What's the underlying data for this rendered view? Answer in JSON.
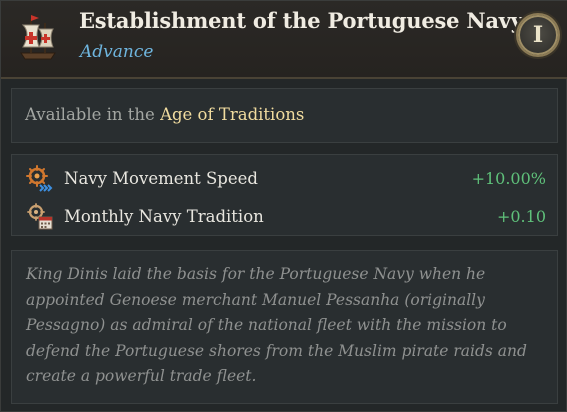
{
  "header": {
    "icon": "caravel-ship-icon",
    "title": "Establishment of the Portuguese Navy",
    "subtitle": "Advance",
    "badge": "I"
  },
  "availability": {
    "prefix": "Available in the ",
    "age": "Age of Traditions"
  },
  "modifiers": [
    {
      "icon": "ship-wheel-speed-icon",
      "label": "Navy Movement Speed",
      "value": "+10.00%"
    },
    {
      "icon": "ship-wheel-calendar-icon",
      "label": "Monthly Navy Tradition",
      "value": "+0.10"
    }
  ],
  "description": "King Dinis laid the basis for the Portuguese Navy when he appointed Genoese merchant Manuel Pessanha (originally Pessagno) as admiral of the national fleet with the mission to defend the Portuguese shores from the Muslim pirate raids and create a powerful trade fleet.",
  "colors": {
    "title": "#f0ece2",
    "subtitle": "#6fb5de",
    "age_highlight": "#f1dc9f",
    "positive_value": "#5fc07a",
    "description": "#8f9190"
  }
}
